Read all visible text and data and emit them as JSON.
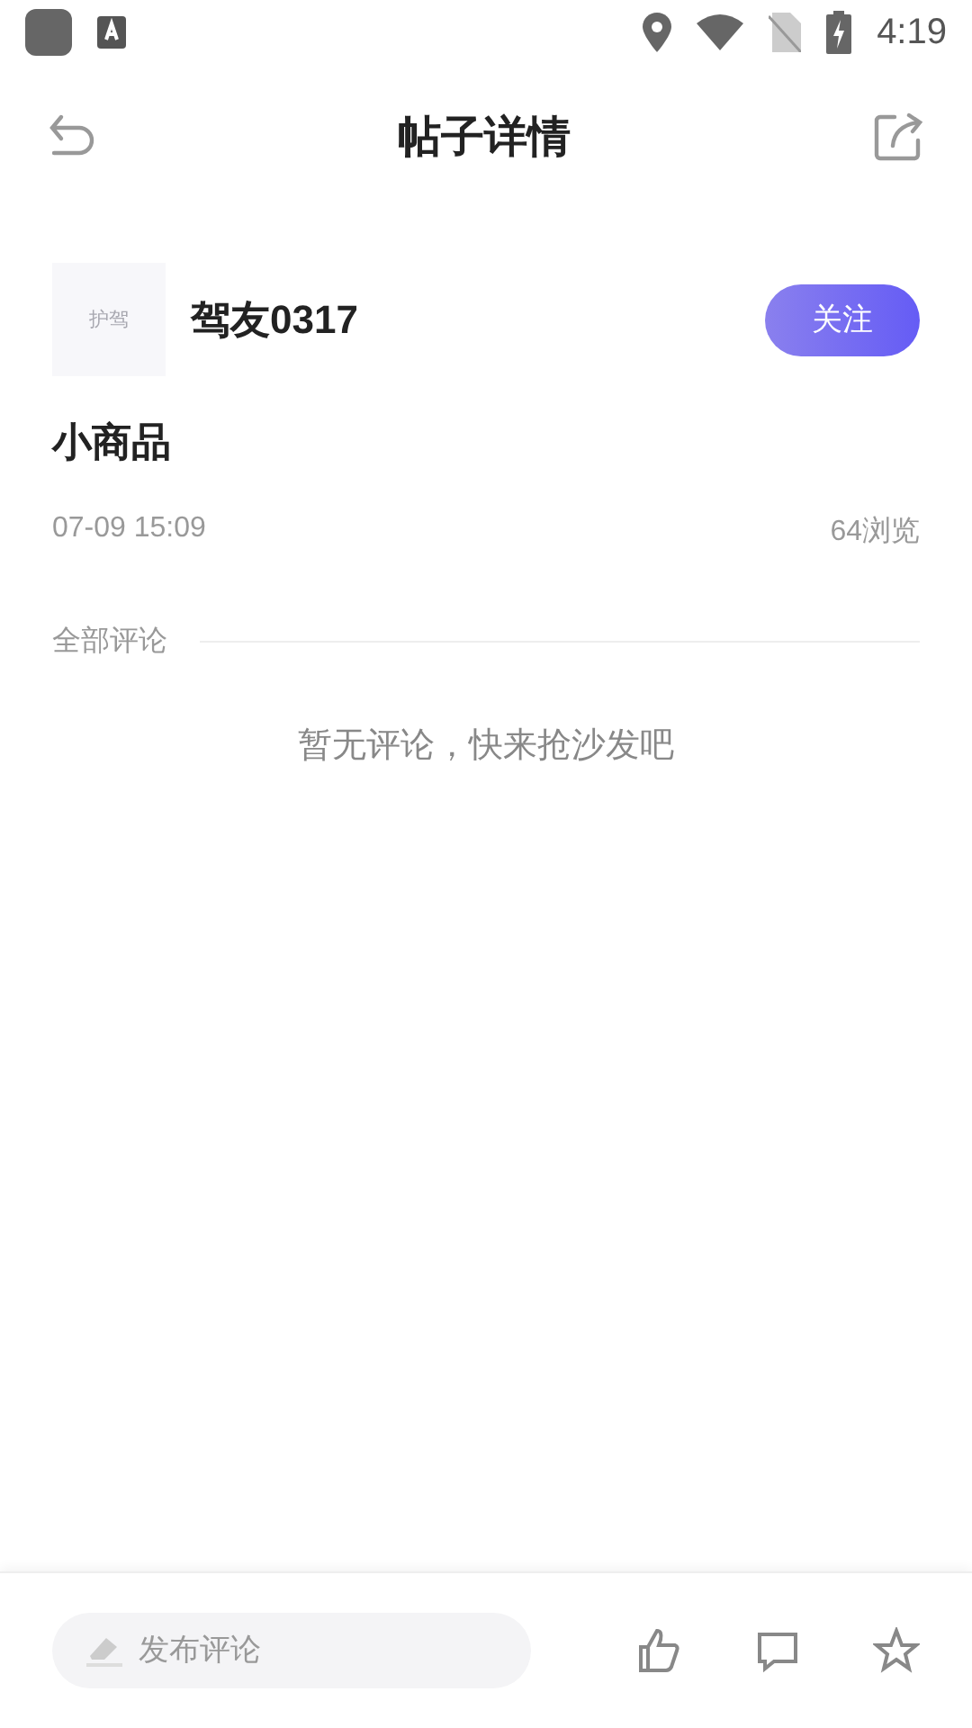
{
  "status_bar": {
    "time": "4:19"
  },
  "header": {
    "title": "帖子详情"
  },
  "author": {
    "avatar_text": "护驾",
    "name": "驾友0317",
    "follow_button": "关注"
  },
  "post": {
    "title": "小商品",
    "date": "07-09 15:09",
    "views": "64浏览"
  },
  "comments": {
    "heading": "全部评论",
    "empty_text": "暂无评论，快来抢沙发吧"
  },
  "bottom_bar": {
    "comment_field": {
      "placeholder": "发布评论"
    }
  }
}
